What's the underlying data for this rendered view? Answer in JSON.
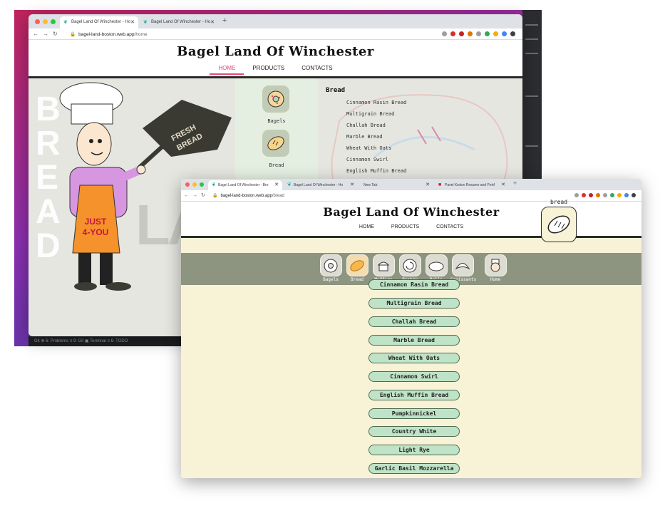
{
  "back_window": {
    "tabs": [
      {
        "label": "Bagel Land Of Winchester - Ho"
      },
      {
        "label": "Bagel Land Of Winchester - Ho"
      }
    ],
    "url_host": "bagel-land-boston.web.app",
    "url_path": "/home",
    "site_title": "Bagel Land Of Winchester",
    "nav": {
      "home": "HOME",
      "products": "PRODUCTS",
      "contacts": "CONTACTS"
    },
    "hero": {
      "vertical_word_letters": [
        "B",
        "R",
        "E",
        "A",
        "D"
      ],
      "background_word": "LAN",
      "peel_text_1": "FRESH",
      "peel_text_2": "BREAD",
      "apron_text_1": "JUST",
      "apron_text_2": "4-YOU"
    },
    "categories": [
      {
        "label": "Bagels",
        "icon": "donut-icon"
      },
      {
        "label": "Bread",
        "icon": "bread-loaf-icon"
      }
    ],
    "list_heading": "Bread",
    "list_items": [
      "Cinnamon Rasin Bread",
      "Multigrain Bread",
      "Challah Bread",
      "Marble Bread",
      "Wheat With Oats",
      "Cinnamon Swirl",
      "English Muffin Bread"
    ],
    "ide_statusbar": "Git   ⊗ 6: Problems   ≡ 9: Git   ▣ Terminal   ≡ 6: TODO"
  },
  "front_window": {
    "tabs": [
      {
        "label": "Bagel Land Of Winchester - Bre"
      },
      {
        "label": "Bagel Land Of Winchester - Ho"
      },
      {
        "label": "New Tab"
      },
      {
        "label": "Pavel Krotov Resume and Portf"
      }
    ],
    "url_host": "bagel-land-boston.web.app",
    "url_path": "/bread",
    "site_title": "Bagel Land Of Winchester",
    "nav": {
      "home": "HOME",
      "products": "PRODUCTS",
      "contacts": "CONTACTS"
    },
    "current_badge": {
      "label": "bread",
      "icon": "bread-loaf-icon"
    },
    "categories": [
      {
        "label": "Bagels",
        "icon": "donut-icon"
      },
      {
        "label": "Bread",
        "icon": "bread-loaf-icon"
      },
      {
        "label": "Muffins",
        "icon": "muffin-icon"
      },
      {
        "label": "Pastry",
        "icon": "pastry-swirl-icon"
      },
      {
        "label": "Rolls",
        "icon": "roll-icon"
      },
      {
        "label": "Croissants",
        "icon": "croissant-icon"
      },
      {
        "label": "Home",
        "icon": "baker-icon"
      }
    ],
    "products": [
      "Cinnamon Rasin Bread",
      "Multigrain Bread",
      "Challah Bread",
      "Marble Bread",
      "Wheat With Oats",
      "Cinnamon Swirl",
      "English Muffin Bread",
      "Pumpkinnickel",
      "Country White",
      "Light Rye",
      "Garlic Basil Mozzarella"
    ]
  },
  "colors": {
    "nav_active": "#e24a7c",
    "category_bar": "#8d9480",
    "product_area": "#f8f3d6",
    "pill_fill": "#bfe3c6",
    "apron": "#f5922b",
    "shirt": "#d796e0",
    "peel": "#3a3a33"
  }
}
